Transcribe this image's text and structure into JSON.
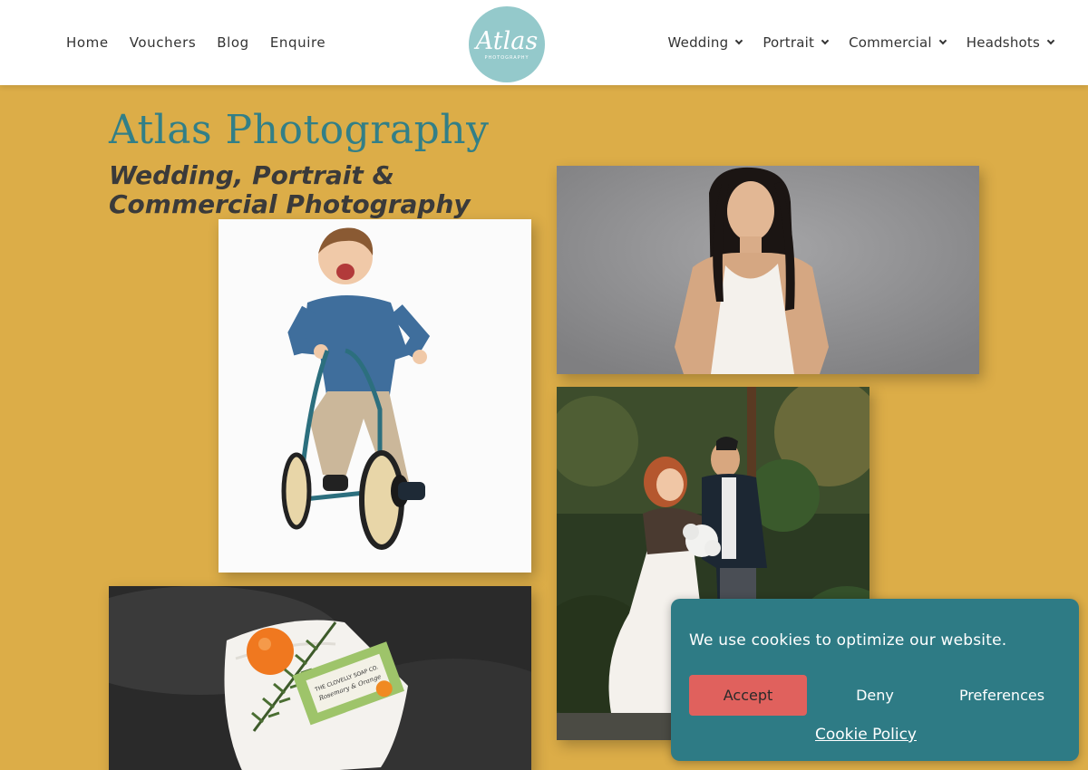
{
  "header": {
    "nav_left": [
      "Home",
      "Vouchers",
      "Blog",
      "Enquire"
    ],
    "logo": {
      "text": "Atlas",
      "subtext": "PHOTOGRAPHY"
    },
    "nav_right": [
      {
        "label": "Wedding",
        "icon": "chevron-down-icon"
      },
      {
        "label": "Portrait",
        "icon": "chevron-down-icon"
      },
      {
        "label": "Commercial",
        "icon": "chevron-down-icon"
      },
      {
        "label": "Headshots",
        "icon": "chevron-down-icon"
      }
    ]
  },
  "hero": {
    "title": "Atlas Photography",
    "subtitle": "Wedding, Portrait & Commercial Photography"
  },
  "gallery": {
    "soap_label_line1": "THE CLOVELLY SOAP CO.",
    "soap_label_line2": "Rosemary & Orange"
  },
  "cookie": {
    "message": "We use cookies to optimize our website.",
    "accept": "Accept",
    "deny": "Deny",
    "preferences": "Preferences",
    "policy_link": "Cookie Policy"
  },
  "colors": {
    "background": "#dcad48",
    "accent": "#327f87",
    "cookie_bg": "#2e7b85",
    "accept_btn": "#e0615d",
    "logo_bg": "#94c9cb"
  }
}
